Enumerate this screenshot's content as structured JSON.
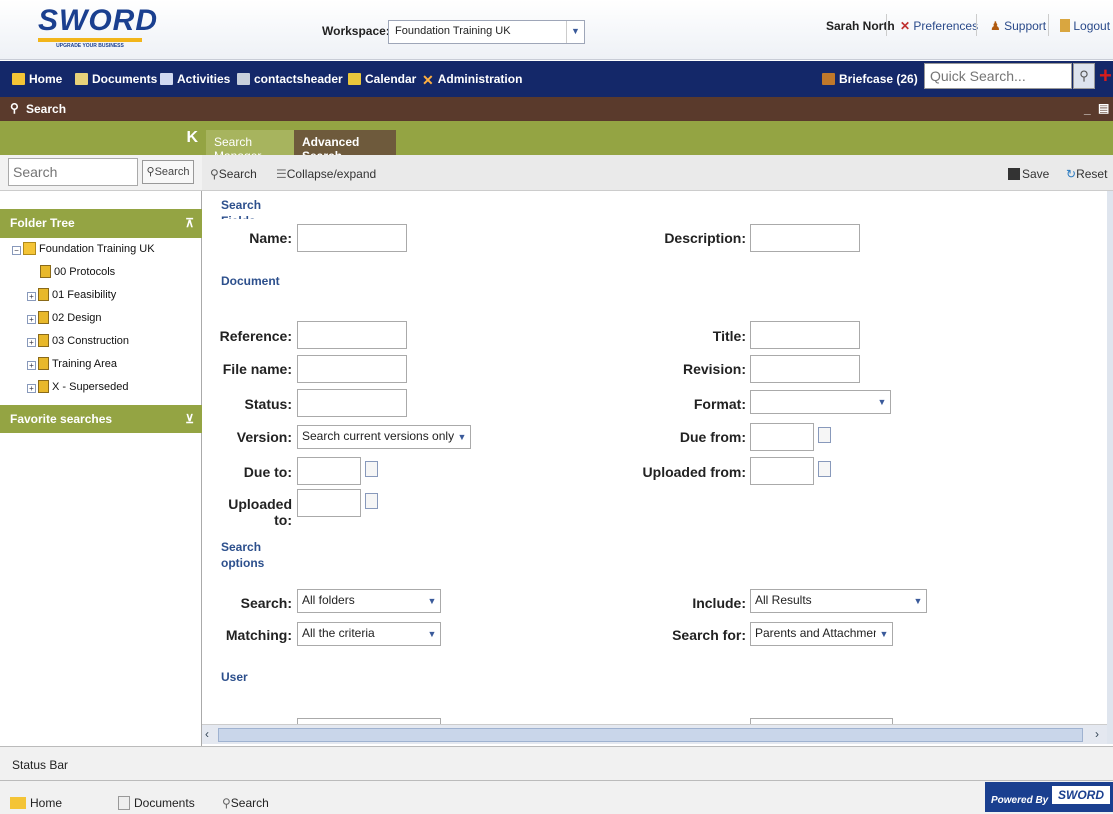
{
  "header": {
    "logo_text": "SWORD",
    "logo_tagline": "UPGRADE YOUR BUSINESS",
    "workspace_label": "Workspace:",
    "workspace_value": "Foundation Training UK",
    "user": "Sarah North",
    "preferences": "Preferences",
    "support": "Support",
    "logout": "Logout"
  },
  "nav": {
    "items": [
      "Home",
      "Documents",
      "Activities",
      "contactsheader",
      "Calendar",
      "Administration"
    ],
    "briefcase": "Briefcase (26)",
    "quick_search_placeholder": "Quick Search..."
  },
  "titlebar": {
    "title": "Search"
  },
  "sidebar": {
    "search_placeholder": "Search",
    "search_button": "Search",
    "folder_tree_title": "Folder Tree",
    "tree": [
      "Foundation Training UK",
      "00 Protocols",
      "01 Feasibility",
      "02 Design",
      "03 Construction",
      "Training Area",
      "X - Superseded"
    ],
    "favorite_searches": "Favorite searches"
  },
  "tabs": [
    "Search Manager",
    "Advanced Search"
  ],
  "toolbar": {
    "search": "Search",
    "collapse": "Collapse/expand",
    "save": "Save",
    "reset": "Reset"
  },
  "form": {
    "search_fields_heading": "Search Fields",
    "document_heading": "Document",
    "search_options_heading": "Search options",
    "user_heading": "User",
    "name": "Name:",
    "description": "Description:",
    "reference": "Reference:",
    "title": "Title:",
    "file_name": "File name:",
    "revision": "Revision:",
    "status": "Status:",
    "format": "Format:",
    "version": "Version:",
    "version_value": "Search current versions only",
    "due_from": "Due from:",
    "due_to": "Due to:",
    "uploaded_from": "Uploaded from:",
    "uploaded_to": "Uploaded to:",
    "search": "Search:",
    "search_value": "All folders",
    "include": "Include:",
    "include_value": "All Results",
    "matching": "Matching:",
    "matching_value": "All the criteria",
    "search_for": "Search for:",
    "search_for_value": "Parents and Attachments"
  },
  "statusbar": {
    "text": "Status Bar"
  },
  "taskbar": {
    "items": [
      "Home",
      "Documents",
      "Search"
    ],
    "powered_by": "Powered By",
    "powered_logo": "SWORD"
  }
}
